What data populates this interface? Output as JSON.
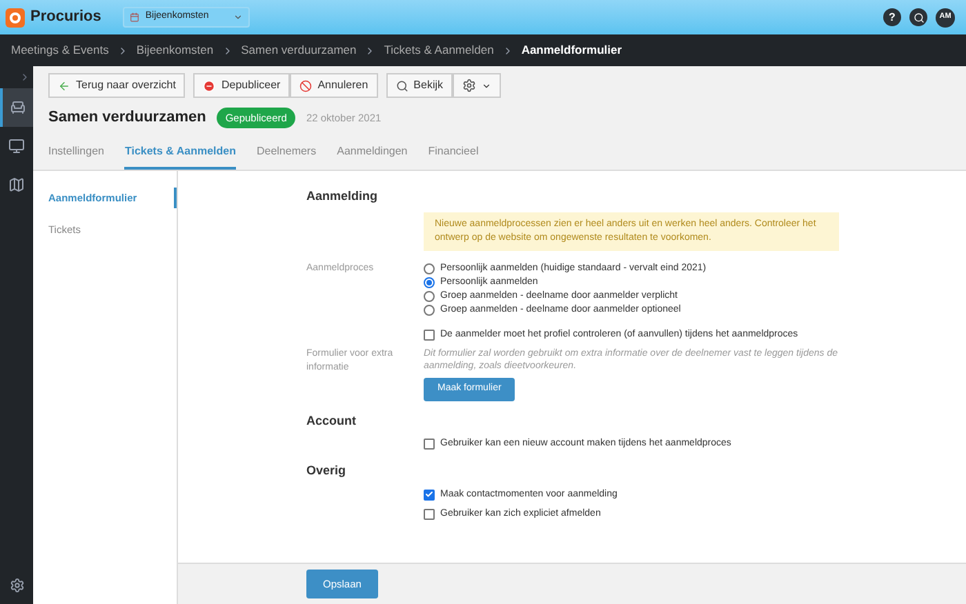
{
  "app_bar": {
    "logo": "Procurios",
    "module_select": "Bijeenkomsten",
    "help": "?",
    "avatar": "AM"
  },
  "breadcrumb": [
    "Meetings & Events",
    "Bijeenkomsten",
    "Samen verduurzamen",
    "Tickets & Aanmelden",
    "Aanmeldformulier"
  ],
  "rail": [
    {
      "kind": "seats",
      "selected": true
    },
    {
      "kind": "desk",
      "selected": false
    },
    {
      "kind": "map",
      "selected": false
    }
  ],
  "toolbar": [
    {
      "kind": "back",
      "label": "Terug naar overzicht"
    },
    {
      "kind": "unpublish",
      "label": "Depubliceer"
    },
    {
      "kind": "cancel",
      "label": "Annuleren"
    },
    {
      "kind": "view",
      "label": "Bekijk"
    },
    {
      "kind": "gear"
    }
  ],
  "title": "Samen verduurzamen",
  "status": "Gepubliceerd",
  "date": "22 oktober 2021",
  "tabs": [
    {
      "label": "Instellingen",
      "selected": false
    },
    {
      "label": "Tickets & Aanmelden",
      "selected": true
    },
    {
      "label": "Deelnemers",
      "selected": false
    },
    {
      "label": "Aanmeldingen",
      "selected": false
    },
    {
      "label": "Financieel",
      "selected": false
    }
  ],
  "subnav": [
    {
      "label": "Aanmeldformulier",
      "selected": true
    },
    {
      "label": "Tickets",
      "selected": false
    }
  ],
  "sections": [
    {
      "heading": "Aanmelding",
      "rows": [
        {
          "kind": "notice",
          "text": "Nieuwe aanmeldprocessen zien er heel anders uit en werken heel anders. Controleer het ontwerp op de website om ongewenste resultaten te voorkomen."
        },
        {
          "kind": "radios",
          "label": "Aanmeldproces",
          "options": [
            {
              "label": "Persoonlijk aanmelden (huidige standaard - vervalt eind 2021)",
              "selected": false
            },
            {
              "label": "Persoonlijk aanmelden",
              "selected": true
            },
            {
              "label": "Groep aanmelden - deelname door aanmelder verplicht",
              "selected": false
            },
            {
              "label": "Groep aanmelden - deelname door aanmelder optioneel",
              "selected": false
            }
          ]
        },
        {
          "kind": "checkbox",
          "label": "De aanmelder moet het profiel controleren (of aanvullen) tijdens het aanmeldproces",
          "checked": false
        },
        {
          "kind": "form",
          "label": "Formulier voor extra informatie",
          "help": "Dit formulier zal worden gebruikt om extra informatie over de deelnemer vast te leggen tijdens de aanmelding, zoals dieetvoorkeuren.",
          "button": "Maak formulier"
        }
      ]
    },
    {
      "heading": "Account",
      "rows": [
        {
          "kind": "checkbox",
          "label": "Gebruiker kan een nieuw account maken tijdens het aanmeldproces",
          "checked": false
        }
      ]
    },
    {
      "heading": "Overig",
      "rows": [
        {
          "kind": "checkbox",
          "label": "Maak contactmomenten voor aanmelding",
          "checked": true
        },
        {
          "kind": "checkbox",
          "label": "Gebruiker kan zich expliciet afmelden",
          "checked": false
        }
      ]
    }
  ],
  "save_button": "Opslaan"
}
